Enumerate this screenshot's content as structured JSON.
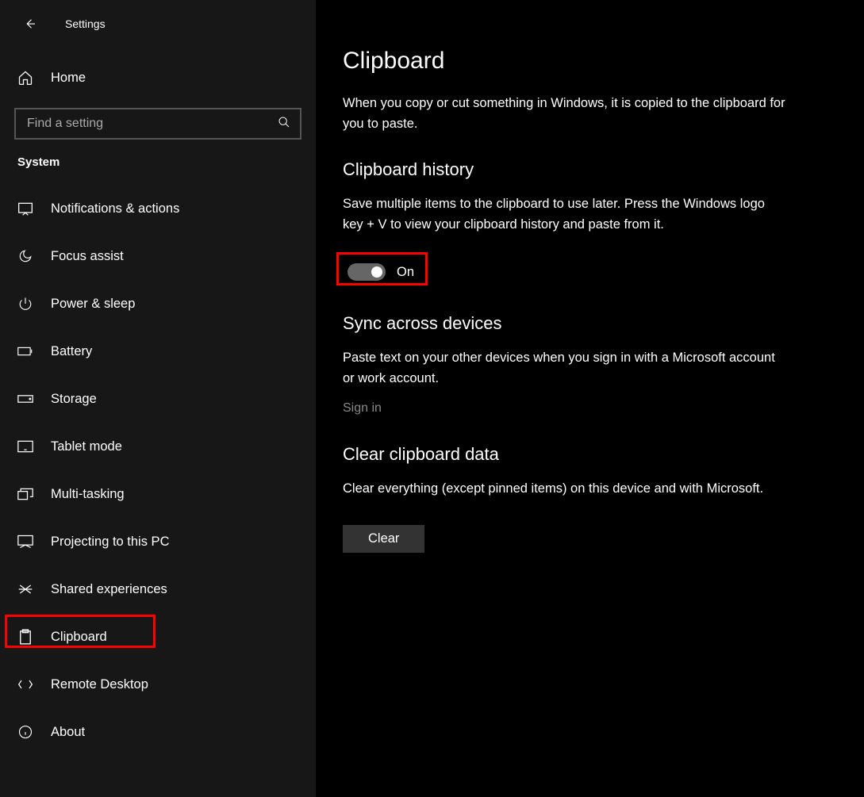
{
  "header": {
    "title": "Settings"
  },
  "home": {
    "label": "Home"
  },
  "search": {
    "placeholder": "Find a setting"
  },
  "section_label": "System",
  "sidebar": {
    "items": [
      {
        "label": "Notifications & actions",
        "icon": "notifications"
      },
      {
        "label": "Focus assist",
        "icon": "moon"
      },
      {
        "label": "Power & sleep",
        "icon": "power"
      },
      {
        "label": "Battery",
        "icon": "battery"
      },
      {
        "label": "Storage",
        "icon": "storage"
      },
      {
        "label": "Tablet mode",
        "icon": "tablet"
      },
      {
        "label": "Multi-tasking",
        "icon": "multitask"
      },
      {
        "label": "Projecting to this PC",
        "icon": "project"
      },
      {
        "label": "Shared experiences",
        "icon": "shared"
      },
      {
        "label": "Clipboard",
        "icon": "clipboard",
        "selected": true
      },
      {
        "label": "Remote Desktop",
        "icon": "remote"
      },
      {
        "label": "About",
        "icon": "about"
      }
    ]
  },
  "main": {
    "title": "Clipboard",
    "intro": "When you copy or cut something in Windows, it is copied to the clipboard for you to paste.",
    "history": {
      "heading": "Clipboard history",
      "desc": "Save multiple items to the clipboard to use later. Press the Windows logo key + V to view your clipboard history and paste from it.",
      "toggle_state": "On"
    },
    "sync": {
      "heading": "Sync across devices",
      "desc": "Paste text on your other devices when you sign in with a Microsoft account or work account.",
      "signin": "Sign in"
    },
    "clear": {
      "heading": "Clear clipboard data",
      "desc": "Clear everything (except pinned items) on this device and with Microsoft.",
      "button": "Clear"
    }
  }
}
